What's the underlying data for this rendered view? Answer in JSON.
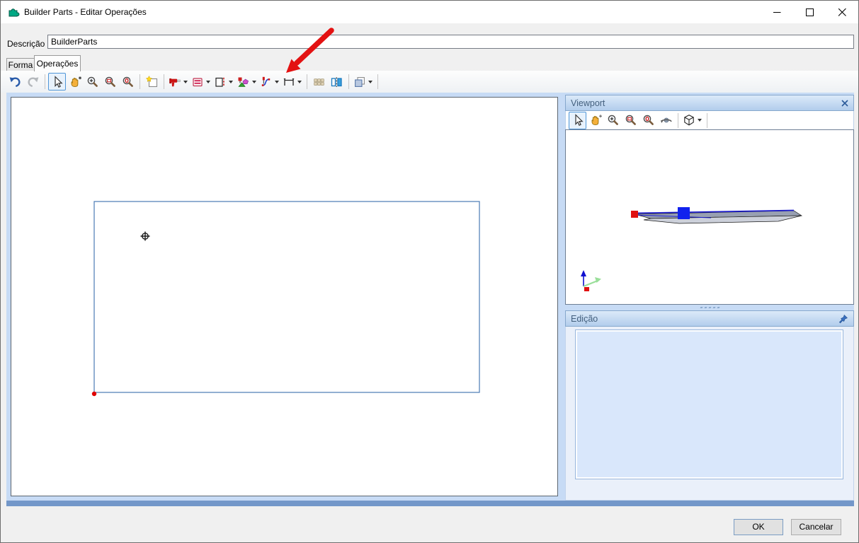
{
  "window": {
    "title": "Builder Parts - Editar Operações",
    "app_icon": "puzzle-piece",
    "icon_color": "#00a884"
  },
  "description": {
    "label": "Descrição",
    "value": "BuilderParts"
  },
  "tabs": [
    {
      "label": "Forma",
      "active": false
    },
    {
      "label": "Operações",
      "active": true
    }
  ],
  "toolbar": {
    "icons": [
      "undo",
      "redo",
      "select",
      "pan",
      "zoom-in",
      "zoom-window",
      "zoom-fit",
      "new-sketch",
      "drill",
      "panel-sections",
      "edge-band",
      "shapes",
      "curve",
      "dimension",
      "bricks",
      "mirror",
      "layers"
    ],
    "active_tool": "select",
    "disabled": [
      "redo",
      "bricks"
    ]
  },
  "annotation": {
    "type": "arrow",
    "color": "#e31212",
    "points_to": "bricks-icon"
  },
  "canvas": {
    "shape": "rectangle-outline",
    "stroke_color": "#4a7ab5",
    "origin_marker_color": "#e00000",
    "symbol": "crosshair-target"
  },
  "viewport": {
    "title": "Viewport",
    "toolbar_icons": [
      "select",
      "pan",
      "zoom-in",
      "zoom-window",
      "zoom-fit",
      "orbit",
      "view-cube"
    ],
    "handles": {
      "red": "#e01010",
      "blue": "#1122ee"
    },
    "axis_colors": {
      "x": "#e01010",
      "y": "#9adf9a",
      "z": "#1010d0"
    }
  },
  "edicao": {
    "title": "Edição"
  },
  "footer": {
    "ok": "OK",
    "cancel": "Cancelar"
  }
}
